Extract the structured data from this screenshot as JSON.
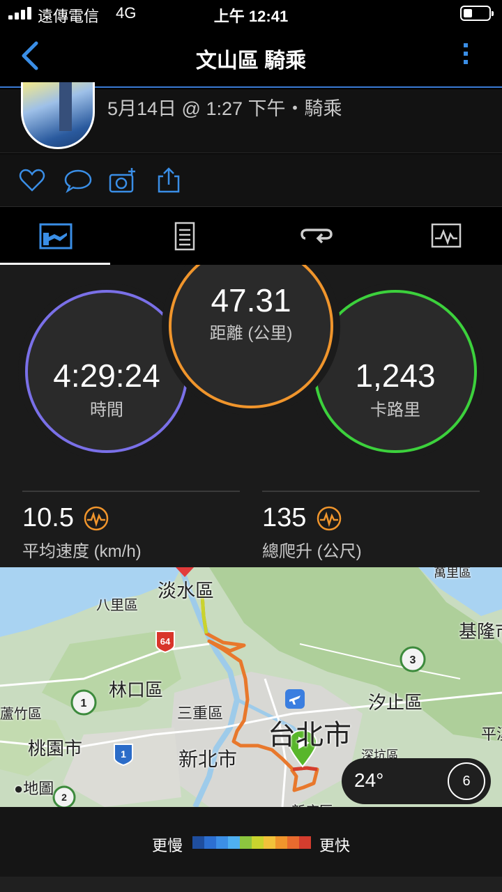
{
  "status_bar": {
    "carrier": "遠傳電信",
    "network": "4G",
    "time": "上午 12:41"
  },
  "nav": {
    "title": "文山區 騎乘"
  },
  "activity": {
    "subtitle": "5月14日 @ 1:27 下午・騎乘"
  },
  "actions": [
    "heart-icon",
    "comment-icon",
    "add-photo-icon",
    "share-icon"
  ],
  "tabs": [
    "summary-tab",
    "details-tab",
    "laps-tab",
    "charts-tab"
  ],
  "stats": {
    "time": {
      "value": "4:29:24",
      "label": "時間"
    },
    "distance": {
      "value": "47.31",
      "label": "距離 (公里)"
    },
    "calories": {
      "value": "1,243",
      "label": "卡路里"
    },
    "avg_speed": {
      "value": "10.5",
      "label": "平均速度 (km/h)"
    },
    "total_ascent": {
      "value": "135",
      "label": "總爬升 (公尺)"
    }
  },
  "map": {
    "places": {
      "tamsui": "淡水區",
      "bali": "八里區",
      "keelung": "基隆市",
      "linkou": "林口區",
      "xizhi": "汐止區",
      "sanchong": "三重區",
      "taipei": "台北市",
      "luzhu": "蘆竹區",
      "taoyuan": "桃園市",
      "new_taipei": "新北市",
      "shenkeng": "深坑區",
      "pingxi": "平溪",
      "wanli": "萬里區",
      "xindian": "新店區"
    },
    "road_signs": {
      "highway64": "64",
      "route1": "1",
      "route3": "3",
      "route1b": "1",
      "route2": "2"
    },
    "attribution": "地圖",
    "weather": {
      "temperature": "24°",
      "wind_speed": "6"
    }
  },
  "legend": {
    "slow": "更慢",
    "fast": "更快",
    "colors": [
      "#1f4e9e",
      "#2c6fd1",
      "#3c8fe6",
      "#4fb0f0",
      "#8cc63f",
      "#c9d42e",
      "#f2c23a",
      "#f0952c",
      "#e86b2e",
      "#d43d2e"
    ]
  },
  "colors": {
    "accent_blue": "#3a8ee6",
    "time_ring": "#7a70e8",
    "distance_ring": "#f0952c",
    "calories_ring": "#3cd13c"
  }
}
